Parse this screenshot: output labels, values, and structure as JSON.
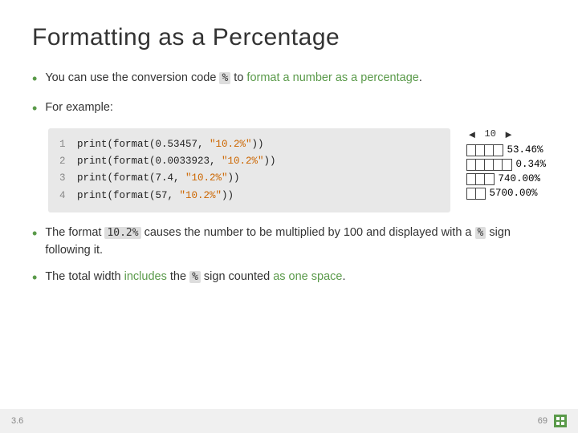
{
  "slide": {
    "title": "Formatting as a Percentage",
    "bullets": [
      {
        "id": "bullet1",
        "text_parts": [
          {
            "text": "You can use the conversion code ",
            "style": "normal"
          },
          {
            "text": "%",
            "style": "code"
          },
          {
            "text": " to ",
            "style": "normal"
          },
          {
            "text": "format a number as a percentage",
            "style": "green"
          },
          {
            "text": ".",
            "style": "normal"
          }
        ]
      },
      {
        "id": "bullet2",
        "text": "For example:"
      },
      {
        "id": "bullet3",
        "text_parts": [
          {
            "text": "The format ",
            "style": "normal"
          },
          {
            "text": "10.2%",
            "style": "code"
          },
          {
            "text": " causes the number to be multiplied by 100 and displayed with a ",
            "style": "normal"
          },
          {
            "text": "%",
            "style": "code"
          },
          {
            "text": " sign following it.",
            "style": "normal"
          }
        ]
      },
      {
        "id": "bullet4",
        "text_parts": [
          {
            "text": "The total width ",
            "style": "normal"
          },
          {
            "text": "includes",
            "style": "green"
          },
          {
            "text": " the ",
            "style": "normal"
          },
          {
            "text": "%",
            "style": "code"
          },
          {
            "text": " sign counted ",
            "style": "normal"
          },
          {
            "text": "as one space",
            "style": "green"
          },
          {
            "text": ".",
            "style": "normal"
          }
        ]
      }
    ],
    "code_lines": [
      {
        "num": "1",
        "code": "print(format(0.53457, ",
        "string": "\"10.2%\"",
        "end": "))"
      },
      {
        "num": "2",
        "code": "print(format(0.0033923, ",
        "string": "\"10.2%\"",
        "end": "))"
      },
      {
        "num": "3",
        "code": "print(format(7.4, ",
        "string": "\"10.2%\"",
        "end": "))"
      },
      {
        "num": "4",
        "code": "print(format(57, ",
        "string": "\"10.2%\"",
        "end": "))"
      }
    ],
    "diagram": {
      "arrow_label": "10",
      "rows": [
        {
          "boxes": 4,
          "value": "53.46%"
        },
        {
          "boxes": 5,
          "value": "0.34%"
        },
        {
          "boxes": 3,
          "value": "740.00%"
        },
        {
          "boxes": 2,
          "value": "5700.00%"
        }
      ]
    },
    "footer": {
      "section": "3.6",
      "page": "69"
    }
  }
}
